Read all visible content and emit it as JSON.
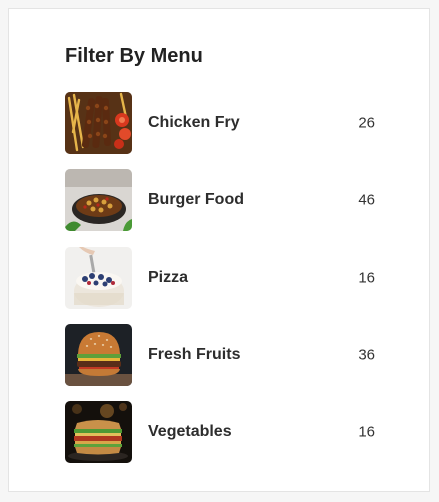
{
  "filter": {
    "title": "Filter By Menu",
    "items": [
      {
        "label": "Chicken Fry",
        "count": "26",
        "image": "chicken-fry-thumbnail"
      },
      {
        "label": "Burger Food",
        "count": "46",
        "image": "burger-food-thumbnail"
      },
      {
        "label": "Pizza",
        "count": "16",
        "image": "pizza-thumbnail"
      },
      {
        "label": "Fresh Fruits",
        "count": "36",
        "image": "fresh-fruits-thumbnail"
      },
      {
        "label": "Vegetables",
        "count": "16",
        "image": "vegetables-thumbnail"
      }
    ]
  }
}
